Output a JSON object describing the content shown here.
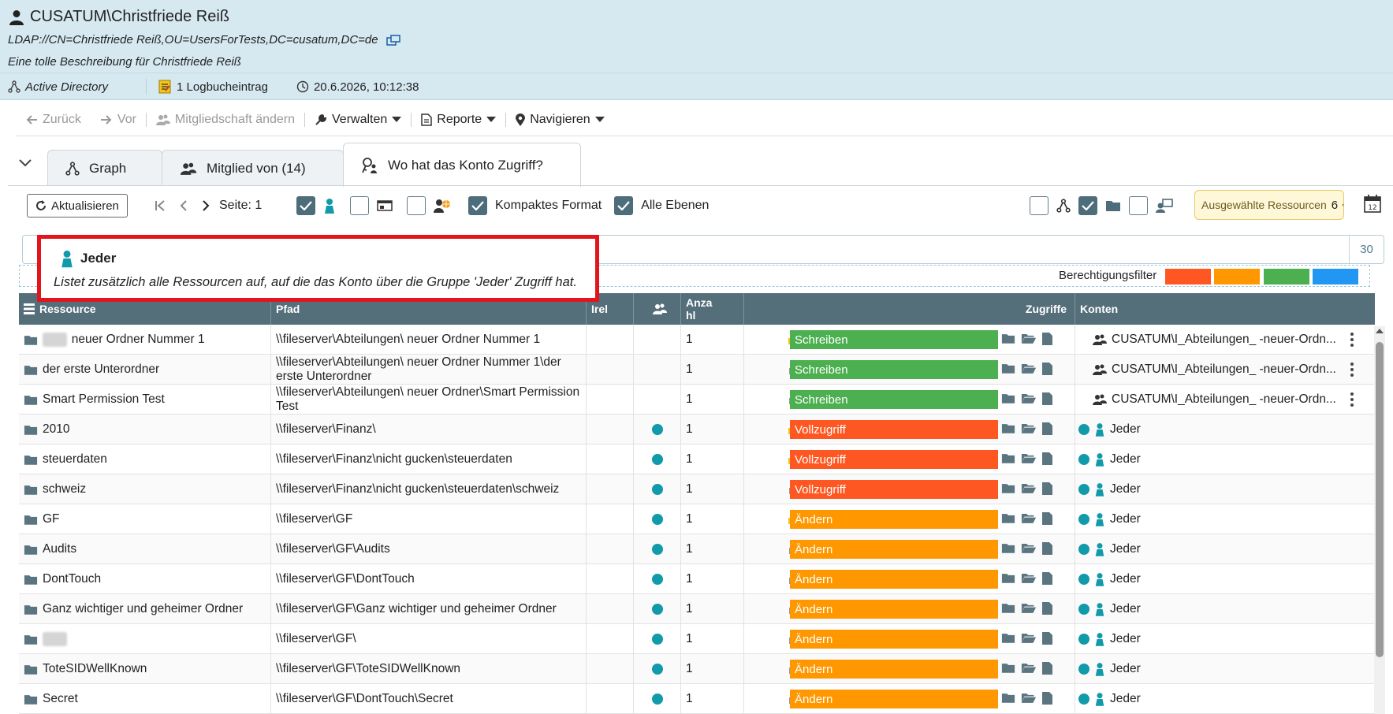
{
  "header": {
    "title": "CUSATUM\\Christfriede Reiß",
    "ldap": "LDAP://CN=Christfriede Reiß,OU=UsersForTests,DC=cusatum,DC=de",
    "description": "Eine tolle Beschreibung für Christfriede Reiß",
    "source": "Active Directory",
    "log_entry": "1 Logbucheintrag",
    "timestamp": "20.6.2026, 10:12:38"
  },
  "toolbar": {
    "back": "Zurück",
    "forward": "Vor",
    "membership": "Mitgliedschaft ändern",
    "manage": "Verwalten",
    "reports": "Reporte",
    "navigate": "Navigieren"
  },
  "tabs": [
    {
      "label": "Graph"
    },
    {
      "label": "Mitglied von (14)"
    },
    {
      "label": "Wo hat das Konto Zugriff?"
    }
  ],
  "tb2": {
    "refresh": "Aktualisieren",
    "page": "Seite: 1",
    "compact": "Kompaktes Format",
    "all_levels": "Alle Ebenen",
    "selected_label": "Ausgewählte Ressourcen",
    "selected_count": "6"
  },
  "filter": {
    "count": "30",
    "perm_label": "Berechtigungsfilter"
  },
  "tooltip": {
    "title": "Jeder",
    "text": "Listet zusätzlich alle Ressourcen auf, auf die das Konto über die Gruppe 'Jeder' Zugriff hat."
  },
  "table": {
    "headers": {
      "resource": "Ressource",
      "path": "Pfad",
      "irel": "Irel",
      "count": "Anza hl",
      "access": "Zugriffe",
      "accounts": "Konten"
    },
    "rows": [
      {
        "resource": "neuer Ordner Nummer 1",
        "path": "\\\\fileserver\\Abteilungen\\ neuer Ordner Nummer 1",
        "count": "1",
        "access": "Schreiben",
        "account": "CUSATUM\\I_Abteilungen_ -neuer-Ordn..."
      },
      {
        "resource": "der erste Unterordner",
        "path": "\\\\fileserver\\Abteilungen\\ neuer Ordner Nummer 1\\der erste Unterordner",
        "count": "1",
        "access": "Schreiben",
        "account": "CUSATUM\\I_Abteilungen_ -neuer-Ordn..."
      },
      {
        "resource": "Smart Permission Test",
        "path": "\\\\fileserver\\Abteilungen\\ neuer Ordner\\Smart Permission Test",
        "count": "1",
        "access": "Schreiben",
        "account": "CUSATUM\\I_Abteilungen_ -neuer-Ordn..."
      },
      {
        "resource": "2010",
        "path": "\\\\fileserver\\Finanz\\",
        "count": "1",
        "access": "Vollzugriff",
        "account": "Jeder"
      },
      {
        "resource": "steuerdaten",
        "path": "\\\\fileserver\\Finanz\\nicht gucken\\steuerdaten",
        "count": "1",
        "access": "Vollzugriff",
        "account": "Jeder"
      },
      {
        "resource": "schweiz",
        "path": "\\\\fileserver\\Finanz\\nicht gucken\\steuerdaten\\schweiz",
        "count": "1",
        "access": "Vollzugriff",
        "account": "Jeder"
      },
      {
        "resource": "GF",
        "path": "\\\\fileserver\\GF",
        "count": "1",
        "access": "Ändern",
        "account": "Jeder"
      },
      {
        "resource": "Audits",
        "path": "\\\\fileserver\\GF\\Audits",
        "count": "1",
        "access": "Ändern",
        "account": "Jeder"
      },
      {
        "resource": "DontTouch",
        "path": "\\\\fileserver\\GF\\DontTouch",
        "count": "1",
        "access": "Ändern",
        "account": "Jeder"
      },
      {
        "resource": "Ganz wichtiger und geheimer Ordner",
        "path": "\\\\fileserver\\GF\\Ganz wichtiger und geheimer Ordner",
        "count": "1",
        "access": "Ändern",
        "account": "Jeder"
      },
      {
        "resource": "",
        "path": "\\\\fileserver\\GF\\",
        "count": "1",
        "access": "Ändern",
        "account": "Jeder"
      },
      {
        "resource": "ToteSIDWellKnown",
        "path": "\\\\fileserver\\GF\\ToteSIDWellKnown",
        "count": "1",
        "access": "Ändern",
        "account": "Jeder"
      },
      {
        "resource": "Secret",
        "path": "\\\\fileserver\\GF\\DontTouch\\Secret",
        "count": "1",
        "access": "Ändern",
        "account": "Jeder"
      }
    ]
  },
  "colors": {
    "vollzugriff": "#ff5722",
    "aendern": "#ff9800",
    "schreiben": "#4caf50",
    "lesen": "#2196f3",
    "header_bg": "#d6e9f1",
    "table_header": "#546e7a",
    "dot": "#119aa9"
  }
}
